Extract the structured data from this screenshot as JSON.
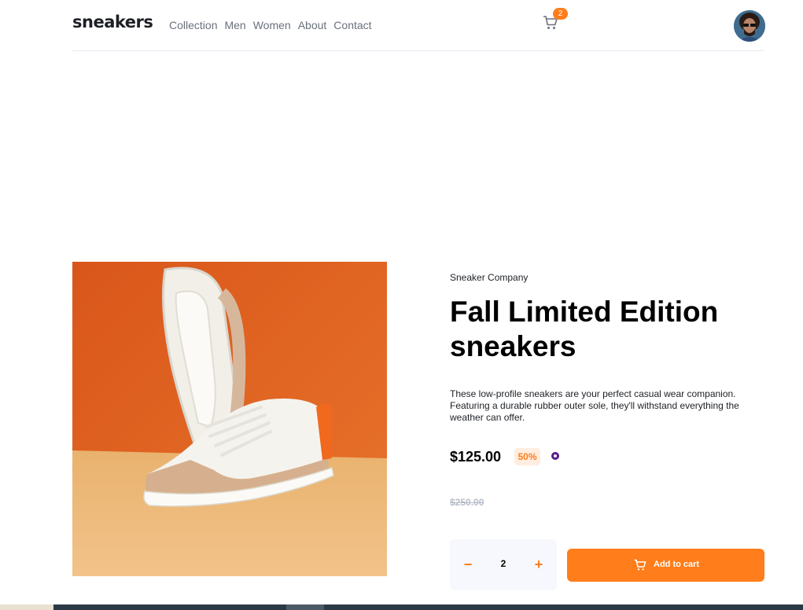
{
  "header": {
    "logo": "sneakers",
    "nav": [
      "Collection",
      "Men",
      "Women",
      "About",
      "Contact"
    ],
    "cart_count": "2",
    "icons": {
      "cart": "cart-icon",
      "avatar": "user-avatar"
    }
  },
  "product": {
    "company": "Sneaker Company",
    "title": "Fall Limited Edition sneakers",
    "description": "These low-profile sneakers are your perfect casual wear companion. Featuring a durable rubber outer sole, they'll withstand everything the weather can offer.",
    "price": "$125.00",
    "discount": "50%",
    "old_price": "$250.00",
    "quantity": "2",
    "minus_label": "−",
    "plus_label": "+",
    "add_to_cart": "Add to cart"
  },
  "colors": {
    "accent": "#ff7d1a",
    "accent_pale": "#ffede0",
    "text_dark": "#1d2025",
    "text_muted": "#69707d",
    "qty_bg": "#f6f8fd"
  }
}
